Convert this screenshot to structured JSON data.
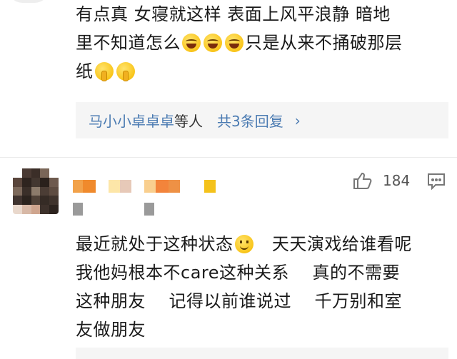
{
  "comment_1": {
    "line_1": "有点真  女寝就这样  表面上风平浪静  暗地",
    "line_2_a": "里不知道怎么",
    "line_2_b": "只是从来不捅破那层",
    "line_3": "纸"
  },
  "replies": {
    "users": "马小小卓卓卓",
    "suffix": "等人",
    "count": "共3条回复",
    "chevron": "›"
  },
  "comment_2": {
    "author_redacted": true,
    "like_count": "184",
    "line_1_a": "最近就处于这种状态",
    "line_1_b": "天天演戏给谁看呢",
    "line_2": "我他妈根本不care这种关系    真的不需要",
    "line_3": "这种朋友    记得以前谁说过    千万别和室",
    "line_4": "友做朋友"
  },
  "icons": {
    "like": "thumbs-up-icon",
    "reply": "comment-bubble-icon",
    "emoji_laugh": "laugh-cry-emoji-icon",
    "emoji_shush": "shush-emoji-icon",
    "emoji_smile": "smile-emoji-icon"
  },
  "colors": {
    "link_blue": "#4b7bb2",
    "reply_bg": "#f5f5f5",
    "text": "#1a1a1a"
  }
}
